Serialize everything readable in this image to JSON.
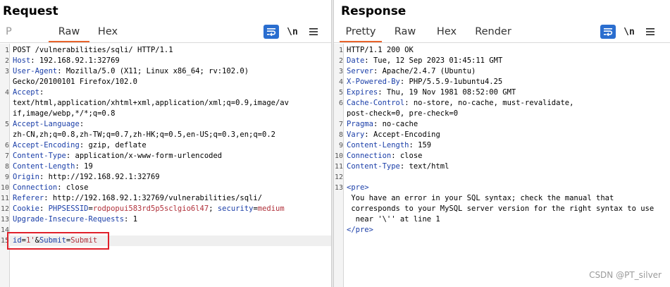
{
  "request": {
    "title": "Request",
    "tabs": [
      {
        "label": "P",
        "active": false,
        "clipped": true
      },
      {
        "label": "Raw",
        "active": true
      },
      {
        "label": "Hex",
        "active": false
      }
    ],
    "newline_label": "\\n",
    "lines": [
      {
        "n": "1",
        "segs": [
          {
            "t": "v",
            "s": "POST /vulnerabilities/sqli/ HTTP/1.1"
          }
        ]
      },
      {
        "n": "2",
        "segs": [
          {
            "t": "k",
            "s": "Host"
          },
          {
            "t": "v",
            "s": ": 192.168.92.1:32769"
          }
        ]
      },
      {
        "n": "3",
        "segs": [
          {
            "t": "k",
            "s": "User-Agent"
          },
          {
            "t": "v",
            "s": ": Mozilla/5.0 (X11; Linux x86_64; rv:102.0)"
          }
        ]
      },
      {
        "n": "",
        "segs": [
          {
            "t": "v",
            "s": "Gecko/20100101 Firefox/102.0"
          }
        ]
      },
      {
        "n": "4",
        "segs": [
          {
            "t": "k",
            "s": "Accept"
          },
          {
            "t": "v",
            "s": ":"
          }
        ]
      },
      {
        "n": "",
        "segs": [
          {
            "t": "v",
            "s": "text/html,application/xhtml+xml,application/xml;q=0.9,image/av"
          }
        ]
      },
      {
        "n": "",
        "segs": [
          {
            "t": "v",
            "s": "if,image/webp,*/*;q=0.8"
          }
        ]
      },
      {
        "n": "5",
        "segs": [
          {
            "t": "k",
            "s": "Accept-Language"
          },
          {
            "t": "v",
            "s": ":"
          }
        ]
      },
      {
        "n": "",
        "segs": [
          {
            "t": "v",
            "s": "zh-CN,zh;q=0.8,zh-TW;q=0.7,zh-HK;q=0.5,en-US;q=0.3,en;q=0.2"
          }
        ]
      },
      {
        "n": "6",
        "segs": [
          {
            "t": "k",
            "s": "Accept-Encoding"
          },
          {
            "t": "v",
            "s": ": gzip, deflate"
          }
        ]
      },
      {
        "n": "7",
        "segs": [
          {
            "t": "k",
            "s": "Content-Type"
          },
          {
            "t": "v",
            "s": ": application/x-www-form-urlencoded"
          }
        ]
      },
      {
        "n": "8",
        "segs": [
          {
            "t": "k",
            "s": "Content-Length"
          },
          {
            "t": "v",
            "s": ": 19"
          }
        ]
      },
      {
        "n": "9",
        "segs": [
          {
            "t": "k",
            "s": "Origin"
          },
          {
            "t": "v",
            "s": ": http://192.168.92.1:32769"
          }
        ]
      },
      {
        "n": "10",
        "segs": [
          {
            "t": "k",
            "s": "Connection"
          },
          {
            "t": "v",
            "s": ": close"
          }
        ]
      },
      {
        "n": "11",
        "segs": [
          {
            "t": "k",
            "s": "Referer"
          },
          {
            "t": "v",
            "s": ": http://192.168.92.1:32769/vulnerabilities/sqli/"
          }
        ]
      },
      {
        "n": "12",
        "segs": [
          {
            "t": "k",
            "s": "Cookie"
          },
          {
            "t": "v",
            "s": ": "
          },
          {
            "t": "k",
            "s": "PHPSESSID"
          },
          {
            "t": "v",
            "s": "="
          },
          {
            "t": "r",
            "s": "rodpopui583rd5p5sclgio6l47"
          },
          {
            "t": "v",
            "s": "; "
          },
          {
            "t": "k",
            "s": "security"
          },
          {
            "t": "v",
            "s": "="
          },
          {
            "t": "r",
            "s": "medium"
          }
        ]
      },
      {
        "n": "13",
        "segs": [
          {
            "t": "k",
            "s": "Upgrade-Insecure-Requests"
          },
          {
            "t": "v",
            "s": ": 1"
          }
        ]
      },
      {
        "n": "14",
        "segs": []
      },
      {
        "n": "15",
        "segs": [
          {
            "t": "k",
            "s": "id"
          },
          {
            "t": "v",
            "s": "="
          },
          {
            "t": "r",
            "s": "1'"
          },
          {
            "t": "v",
            "s": "&"
          },
          {
            "t": "k",
            "s": "Submit"
          },
          {
            "t": "v",
            "s": "="
          },
          {
            "t": "r",
            "s": "Submit"
          }
        ],
        "highlight": true
      }
    ]
  },
  "response": {
    "title": "Response",
    "tabs": [
      {
        "label": "Pretty",
        "active": true
      },
      {
        "label": "Raw",
        "active": false
      },
      {
        "label": "Hex",
        "active": false
      },
      {
        "label": "Render",
        "active": false
      }
    ],
    "newline_label": "\\n",
    "lines": [
      {
        "n": "1",
        "segs": [
          {
            "t": "v",
            "s": "HTTP/1.1 200 OK"
          }
        ]
      },
      {
        "n": "2",
        "segs": [
          {
            "t": "k",
            "s": "Date"
          },
          {
            "t": "v",
            "s": ": Tue, 12 Sep 2023 01:45:11 GMT"
          }
        ]
      },
      {
        "n": "3",
        "segs": [
          {
            "t": "k",
            "s": "Server"
          },
          {
            "t": "v",
            "s": ": Apache/2.4.7 (Ubuntu)"
          }
        ]
      },
      {
        "n": "4",
        "segs": [
          {
            "t": "k",
            "s": "X-Powered-By"
          },
          {
            "t": "v",
            "s": ": PHP/5.5.9-1ubuntu4.25"
          }
        ]
      },
      {
        "n": "5",
        "segs": [
          {
            "t": "k",
            "s": "Expires"
          },
          {
            "t": "v",
            "s": ": Thu, 19 Nov 1981 08:52:00 GMT"
          }
        ]
      },
      {
        "n": "6",
        "segs": [
          {
            "t": "k",
            "s": "Cache-Control"
          },
          {
            "t": "v",
            "s": ": no-store, no-cache, must-revalidate,"
          }
        ]
      },
      {
        "n": "",
        "segs": [
          {
            "t": "v",
            "s": "post-check=0, pre-check=0"
          }
        ]
      },
      {
        "n": "7",
        "segs": [
          {
            "t": "k",
            "s": "Pragma"
          },
          {
            "t": "v",
            "s": ": no-cache"
          }
        ]
      },
      {
        "n": "8",
        "segs": [
          {
            "t": "k",
            "s": "Vary"
          },
          {
            "t": "v",
            "s": ": Accept-Encoding"
          }
        ]
      },
      {
        "n": "9",
        "segs": [
          {
            "t": "k",
            "s": "Content-Length"
          },
          {
            "t": "v",
            "s": ": 159"
          }
        ]
      },
      {
        "n": "10",
        "segs": [
          {
            "t": "k",
            "s": "Connection"
          },
          {
            "t": "v",
            "s": ": close"
          }
        ]
      },
      {
        "n": "11",
        "segs": [
          {
            "t": "k",
            "s": "Content-Type"
          },
          {
            "t": "v",
            "s": ": text/html"
          }
        ]
      },
      {
        "n": "12",
        "segs": []
      },
      {
        "n": "13",
        "segs": [
          {
            "t": "k",
            "s": "<pre>"
          }
        ]
      },
      {
        "n": "",
        "segs": [
          {
            "t": "v",
            "s": " You have an error in your SQL syntax; check the manual that"
          }
        ]
      },
      {
        "n": "",
        "segs": [
          {
            "t": "v",
            "s": " corresponds to your MySQL server version for the right syntax to use"
          }
        ]
      },
      {
        "n": "",
        "segs": [
          {
            "t": "v",
            "s": "  near '\\'' at line 1"
          }
        ]
      },
      {
        "n": "",
        "segs": [
          {
            "t": "k",
            "s": "</pre>"
          }
        ]
      }
    ]
  },
  "watermark": "CSDN @PT_silver",
  "colors": {
    "accent": "#e8632b",
    "button_blue": "#2a6ecf",
    "header_name": "#1a3ea8",
    "param_value": "#b0303a",
    "annotation_box": "#e0202a"
  }
}
